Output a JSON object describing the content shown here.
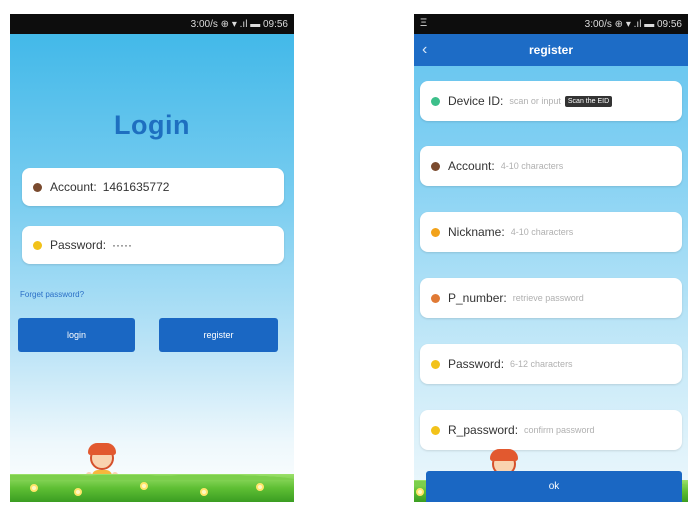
{
  "login_screen": {
    "status_bar": {
      "text": "3:00/s ⊕ ▾ .ıl ▬ 09:56"
    },
    "title": "Login",
    "account": {
      "label": "Account:",
      "value": "1461635772",
      "dot_color": "#7a4a2e"
    },
    "password": {
      "label": "Password:",
      "value": "·····",
      "dot_color": "#f2c21a"
    },
    "forgot_link": "Forget password?",
    "login_button": "login",
    "register_button": "register"
  },
  "register_screen": {
    "status_bar": {
      "left": "Ξ",
      "text": "3:00/s ⊕ ▾ .ıl ▬ 09:56"
    },
    "nav": {
      "back_icon": "‹",
      "title": "register"
    },
    "fields": [
      {
        "label": "Device ID:",
        "placeholder": "scan or input",
        "dot_color": "#3cbf8a",
        "action": "Scan the EID"
      },
      {
        "label": "Account:",
        "placeholder": "4-10 characters",
        "dot_color": "#7a4a2e"
      },
      {
        "label": "Nickname:",
        "placeholder": "4-10 characters",
        "dot_color": "#f2a21a"
      },
      {
        "label": "P_number:",
        "placeholder": "retrieve password",
        "dot_color": "#e07a35"
      },
      {
        "label": "Password:",
        "placeholder": "6-12 characters",
        "dot_color": "#f2c21a"
      },
      {
        "label": "R_password:",
        "placeholder": "confirm password",
        "dot_color": "#f2c21a"
      }
    ],
    "ok_button": "ok"
  },
  "colors": {
    "brand_blue": "#1a67c3",
    "title_blue": "#1e6fc0",
    "sky_top": "#3cb6e8"
  }
}
